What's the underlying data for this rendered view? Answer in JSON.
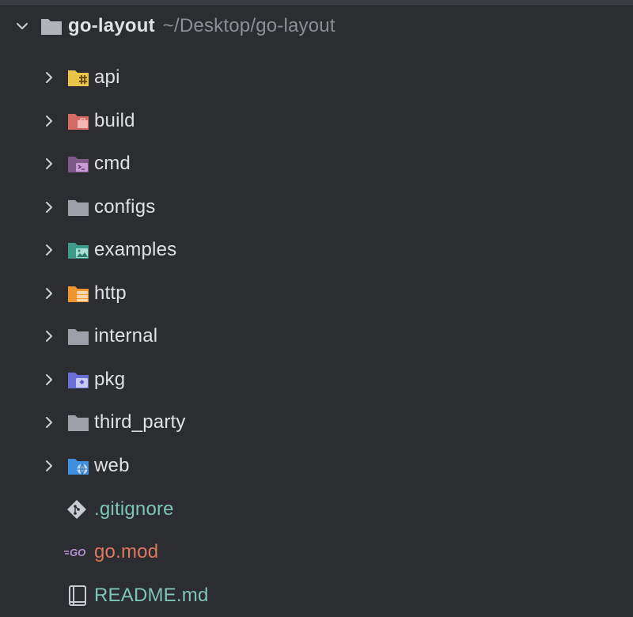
{
  "project": {
    "name": "go-layout",
    "path": "~/Desktop/go-layout",
    "icon": "folder-icon"
  },
  "folders": [
    {
      "label": "api",
      "icon": "api-folder-icon",
      "color": "#e8c547"
    },
    {
      "label": "build",
      "icon": "build-folder-icon",
      "color": "#d46a64"
    },
    {
      "label": "cmd",
      "icon": "cmd-folder-icon",
      "color": "#7d5a8a"
    },
    {
      "label": "configs",
      "icon": "folder-icon",
      "color": "#9da0a6"
    },
    {
      "label": "examples",
      "icon": "examples-folder-icon",
      "color": "#3d9b8a"
    },
    {
      "label": "http",
      "icon": "http-folder-icon",
      "color": "#f0952e"
    },
    {
      "label": "internal",
      "icon": "folder-icon",
      "color": "#9da0a6"
    },
    {
      "label": "pkg",
      "icon": "pkg-folder-icon",
      "color": "#6a6fd6"
    },
    {
      "label": "third_party",
      "icon": "folder-icon",
      "color": "#9da0a6"
    },
    {
      "label": "web",
      "icon": "web-folder-icon",
      "color": "#3d8fe0"
    }
  ],
  "files": [
    {
      "label": ".gitignore",
      "icon": "git-icon",
      "color": "#7ec4b8"
    },
    {
      "label": "go.mod",
      "icon": "go-icon",
      "color": "#e0775f"
    },
    {
      "label": "README.md",
      "icon": "markdown-book-icon",
      "color": "#7ec4b8"
    }
  ]
}
